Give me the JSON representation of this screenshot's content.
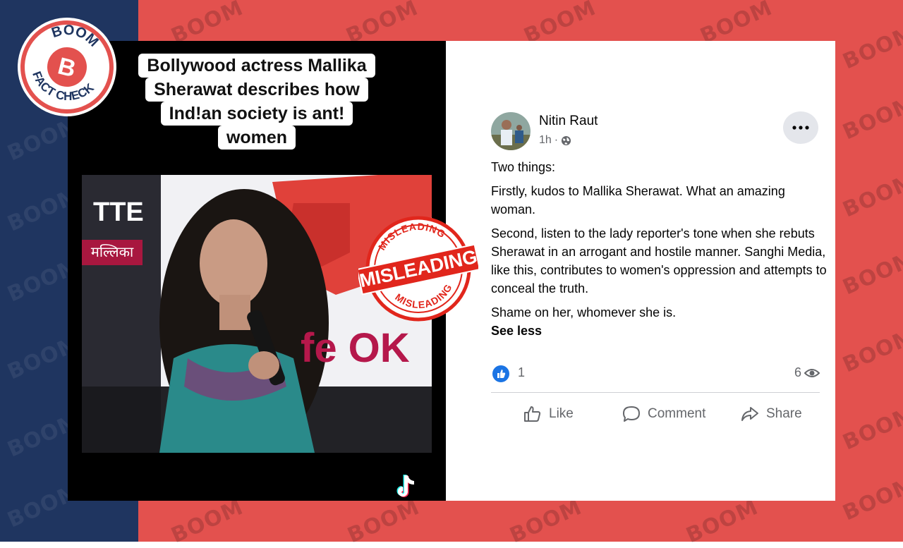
{
  "logo": {
    "top_text": "BOOM",
    "letter": "B",
    "bottom_text": "FACT CHECK"
  },
  "watermark": "BOOM",
  "video": {
    "caption_lines": [
      "Bollywood actress Mallika",
      "Sherawat describes how",
      "Ind!an society is ant!",
      "women"
    ],
    "banner_left_text": "TTE",
    "banner_left_hindi": "मल्लिका",
    "banner_brand_text": "fe OK",
    "platform_icon": "tiktok-icon"
  },
  "stamp": {
    "main": "MISLEADING",
    "ring_top": "MISLEADING",
    "ring_bottom": "MISLEADING",
    "color": "#e1261c"
  },
  "post": {
    "author": "Nitin Raut",
    "time": "1h",
    "audience_icon": "globe-icon",
    "paragraphs": [
      "Two things:",
      "Firstly, kudos to Mallika Sherawat. What an amazing woman.",
      "Second, listen to the lady reporter's tone when she rebuts Sherawat in an arrogant and hostile manner. Sanghi Media, like this, contributes to women's oppression and attempts to conceal the truth.",
      "Shame on her, whomever she is."
    ],
    "see_less": "See less",
    "reaction_count": "1",
    "views": "6",
    "actions": {
      "like": "Like",
      "comment": "Comment",
      "share": "Share"
    }
  },
  "colors": {
    "navy": "#1f3560",
    "red": "#e3514e",
    "fb_blue": "#1b74e4"
  }
}
